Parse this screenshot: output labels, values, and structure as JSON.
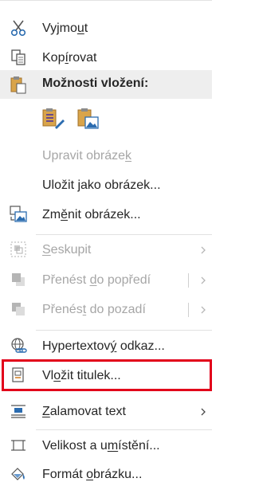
{
  "menu": {
    "cut": {
      "pre": "Vyjmo",
      "key": "u",
      "post": "t"
    },
    "copy": {
      "pre": "Kop",
      "key": "í",
      "post": "rovat"
    },
    "paste_options": {
      "label": "Možnosti vložení:"
    },
    "edit_image": {
      "pre": "Upravit obráze",
      "key": "k",
      "post": ""
    },
    "save_as_image": {
      "pre": "Uložit ",
      "key": "j",
      "post": "ako obrázek..."
    },
    "change_image": {
      "pre": "Zm",
      "key": "ě",
      "post": "nit obrázek..."
    },
    "group": {
      "pre": "",
      "key": "S",
      "post": "eskupit"
    },
    "bring_forward": {
      "pre": "Přenést ",
      "key": "d",
      "post": "o popředí"
    },
    "send_backward": {
      "pre": "Přenés",
      "key": "t",
      "post": " do pozadí"
    },
    "hyperlink": {
      "pre": "Hypertextov",
      "key": "ý",
      "post": " odkaz..."
    },
    "insert_caption": {
      "pre": "Vl",
      "key": "o",
      "post": "žit titulek..."
    },
    "wrap_text": {
      "pre": "",
      "key": "Z",
      "post": "alamovat text"
    },
    "size_position": {
      "pre": "Velikost a u",
      "key": "m",
      "post": "ístění..."
    },
    "format_picture": {
      "pre": "Formát ",
      "key": "o",
      "post": "brázku..."
    }
  },
  "colors": {
    "text": "#262626",
    "disabled_text": "#a6a6a6",
    "header_bg": "#eeeeee",
    "highlight_border": "#e2001a",
    "accent_orange": "#d07a1c",
    "accent_blue": "#2b6cb0"
  }
}
